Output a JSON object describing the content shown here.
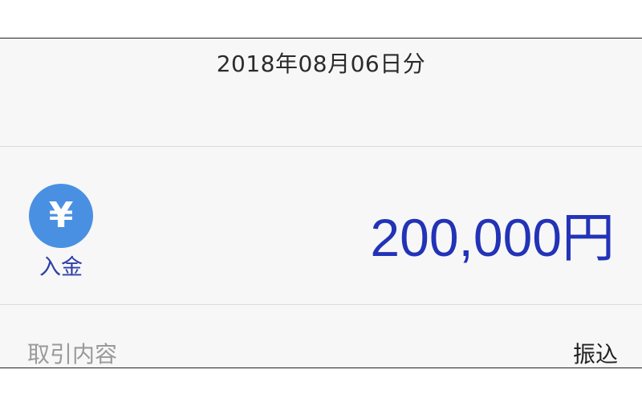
{
  "header": {
    "date": "2018年08月06日分"
  },
  "transaction": {
    "type_icon": "yen-icon",
    "type_icon_glyph": "¥",
    "type_label": "入金",
    "amount": "200,000円",
    "icon_color": "#4a90e2",
    "amount_color": "#2233b8"
  },
  "details": {
    "label": "取引内容",
    "value": "振込"
  }
}
